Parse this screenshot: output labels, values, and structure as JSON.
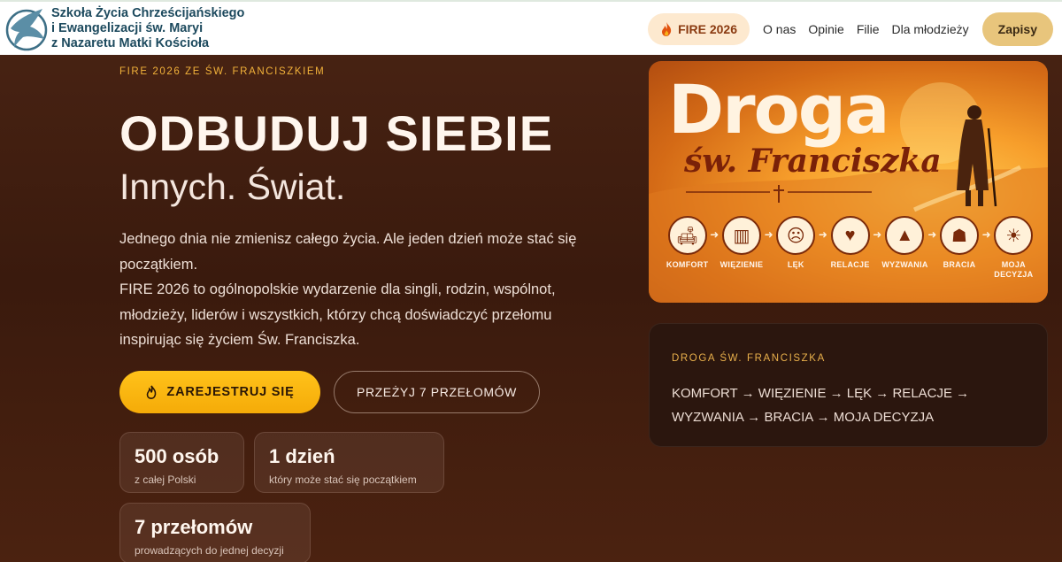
{
  "header": {
    "logo_lines": [
      "Szkoła Życia Chrześcijańskiego",
      "i Ewangelizacji św. Maryi",
      "z Nazaretu Matki Kościoła"
    ],
    "nav": {
      "fire_label": "FIRE 2026",
      "links": [
        "O nas",
        "Opinie",
        "Filie",
        "Dla młodzieży"
      ],
      "cta_label": "Zapisy"
    }
  },
  "hero": {
    "eyebrow": "FIRE 2026 ZE ŚW. FRANCISZKIEM",
    "title": "ODBUDUJ SIEBIE",
    "subtitle": "Innych. Świat.",
    "description_lines": [
      "Jednego dnia nie zmienisz całego życia. Ale jeden dzień może stać się początkiem.",
      "FIRE 2026 to ogólnopolskie wydarzenie dla singli, rodzin, wspólnot, młodzieży, liderów i wszystkich, którzy chcą doświadczyć przełomu inspirując się życiem Św. Franciszka."
    ],
    "primary_button": "ZAREJESTRUJ SIĘ",
    "secondary_button": "PRZEŻYJ 7 PRZEŁOMÓW",
    "stats": [
      {
        "value": "500 osób",
        "label": "z całej Polski"
      },
      {
        "value": "1 dzień",
        "label": "który może stać się początkiem"
      },
      {
        "value": "7 przełomów",
        "label": "prowadzących do jednej decyzji"
      }
    ]
  },
  "art": {
    "title_line1": "Droga",
    "title_line2": "św. Franciszka",
    "steps": [
      {
        "label": "KOMFORT",
        "icon": "armchair-icon"
      },
      {
        "label": "WIĘZIENIE",
        "icon": "prison-bars-icon"
      },
      {
        "label": "LĘK",
        "icon": "fear-face-icon"
      },
      {
        "label": "RELACJE",
        "icon": "people-heart-icon"
      },
      {
        "label": "WYZWANIA",
        "icon": "mountain-flag-icon"
      },
      {
        "label": "BRACIA",
        "icon": "group-icon"
      },
      {
        "label": "MOJA DECYZJA",
        "icon": "person-light-icon"
      }
    ]
  },
  "info_card": {
    "eyebrow": "DROGA ŚW. FRANCISZKA",
    "path_line1": "KOMFORT → WIĘZIENIE → LĘK → RELACJE →",
    "path_line2": "WYZWANIA → BRACIA → MOJA DECYZJA"
  },
  "colors": {
    "accent": "#f5ab08",
    "eyebrow": "#f2b23a",
    "background": "#3a1a0d",
    "header_logo_text": "#1d4a5e"
  }
}
